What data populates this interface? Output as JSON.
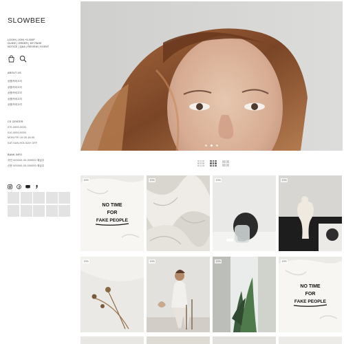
{
  "brand": {
    "logo": "SLOWBEE"
  },
  "top_links": {
    "line1": "LOGIN | JOIN +5,000P",
    "line2": "GUIDE | ORDER | MY PAGE",
    "line3": "NOTICE | Q&A | REVIEW | EVENT"
  },
  "header_icons": [
    "shopping-bag-icon",
    "search-icon"
  ],
  "about": {
    "title": "ABOUT US",
    "menu": [
      "상품카테고리",
      "상품카테고리",
      "상품카테고리",
      "상품카테고리",
      "상품카테고리"
    ]
  },
  "cs_center": {
    "title": "CS CENTER",
    "lines": [
      "070-0000-0000",
      "010-0000-0000",
      "MON-FRI 10:00-18:00",
      "SAT.SUN.HOLIDAY OFF"
    ]
  },
  "bank_info": {
    "title": "BANK INFO",
    "lines": [
      "국민 000000-00-000000 예금주",
      "신한 000000-00-000000 예금주"
    ]
  },
  "social_icons": [
    "instagram-icon",
    "facebook-icon",
    "blog-icon",
    "kakao-icon"
  ],
  "hero": {
    "slide_count": 3,
    "active_slide": 1
  },
  "view_modes": {
    "options": [
      "grid-4",
      "grid-3",
      "grid-2"
    ],
    "active": "grid-3"
  },
  "products": [
    {
      "badge": "19%",
      "image": "tshirt-no-time-fake-people"
    },
    {
      "badge": "19%",
      "image": "white-linen-fabric"
    },
    {
      "badge": "19%",
      "image": "white-vase-still-life"
    },
    {
      "badge": "19%",
      "image": "sculpture-and-magazine"
    },
    {
      "badge": "19%",
      "image": "dried-flowers"
    },
    {
      "badge": "19%",
      "image": "woman-on-chair"
    },
    {
      "badge": "19%",
      "image": "plants-through-window"
    },
    {
      "badge": "19%",
      "image": "tshirt-no-time-fake-people"
    }
  ],
  "colors": {
    "accent": "#222222",
    "placeholder": "#e3e3e3",
    "badge_text": "#666666"
  }
}
